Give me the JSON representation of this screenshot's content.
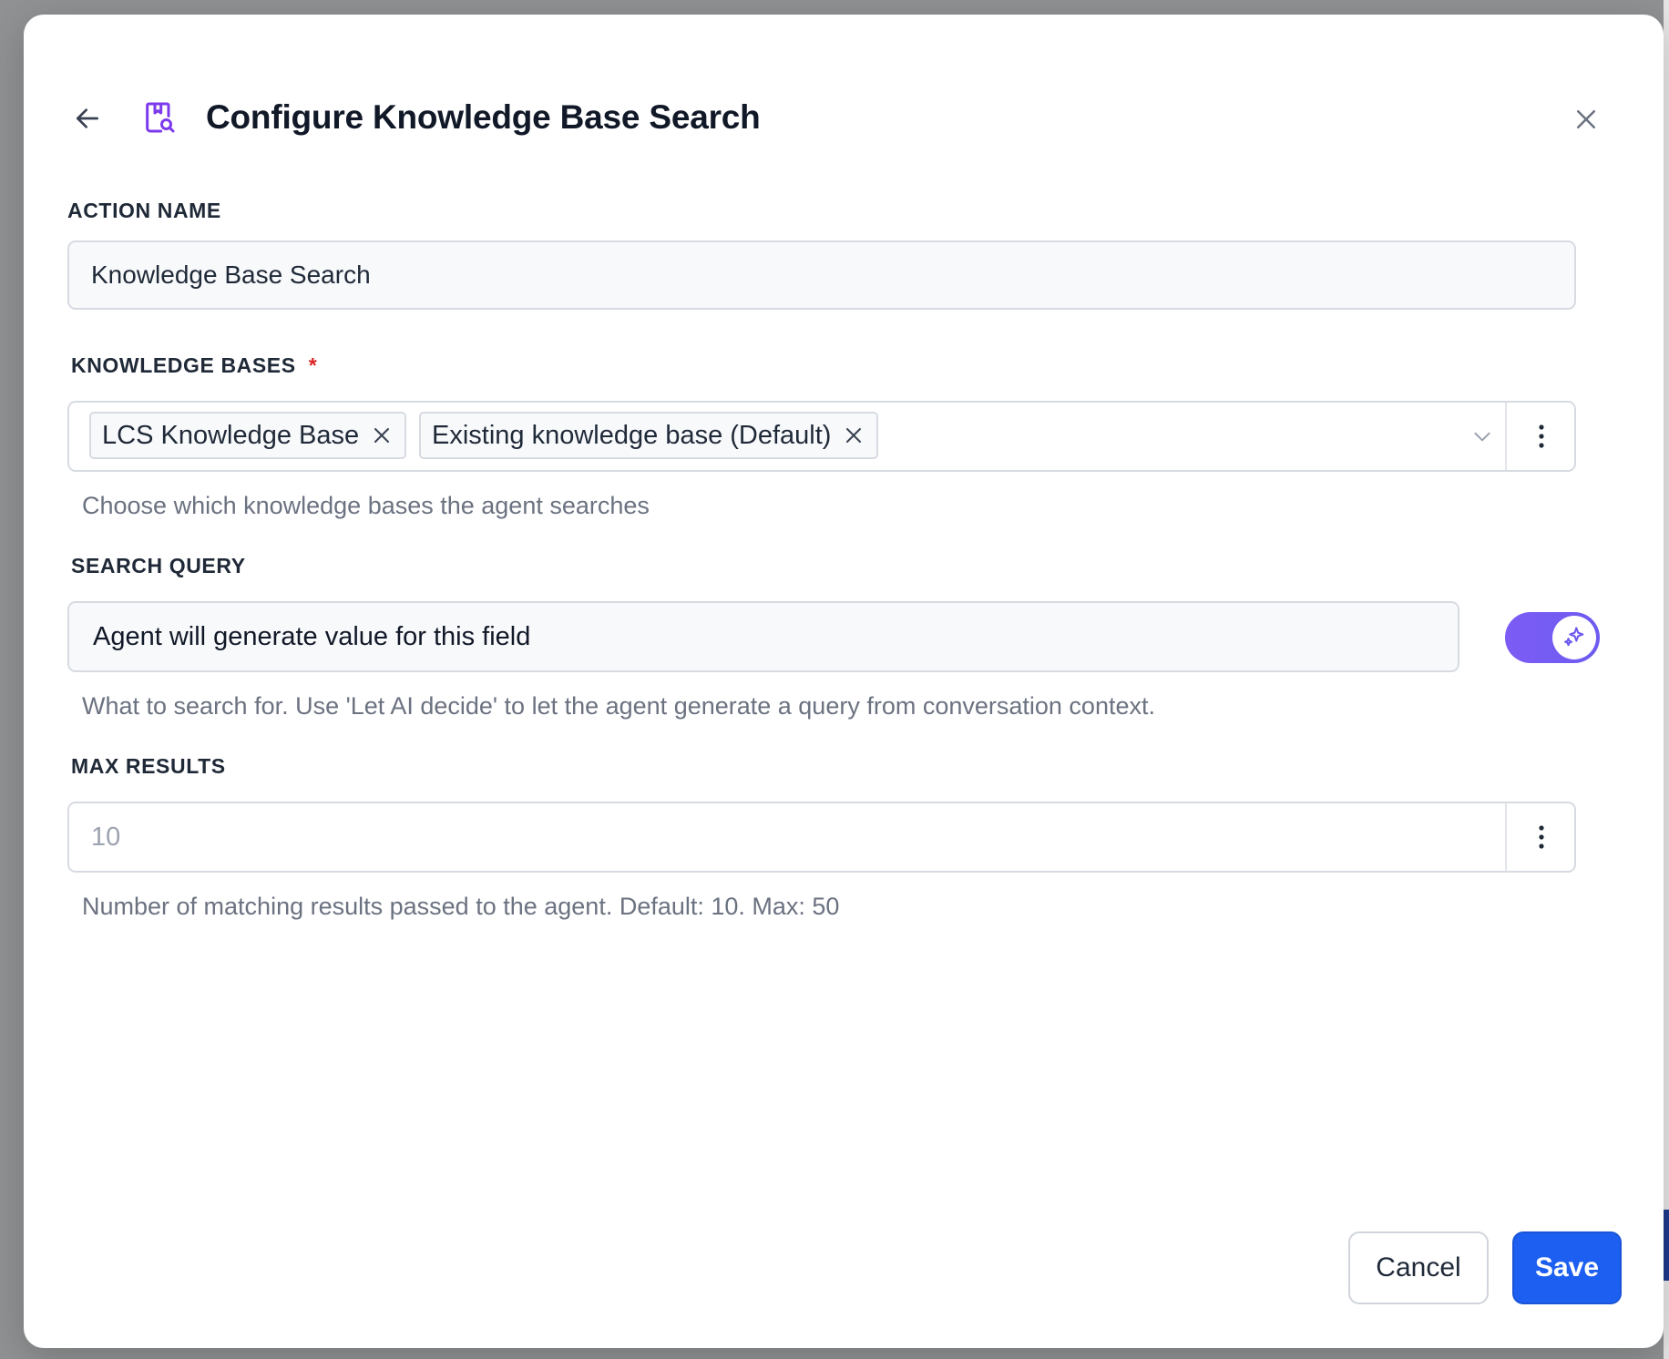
{
  "dialog": {
    "title": "Configure Knowledge Base Search",
    "icons": {
      "back": "arrow-left-icon",
      "title": "knowledge-base-search-icon",
      "close": "close-icon"
    }
  },
  "action_name": {
    "label": "ACTION NAME",
    "value": "Knowledge Base Search"
  },
  "knowledge_bases": {
    "label": "KNOWLEDGE BASES",
    "required_marker": "*",
    "chips": [
      {
        "label": "LCS Knowledge Base"
      },
      {
        "label": "Existing knowledge base (Default)"
      }
    ],
    "help": "Choose which knowledge bases the agent searches"
  },
  "search_query": {
    "label": "SEARCH QUERY",
    "value": "Agent will generate value for this field",
    "ai_toggle_on": true,
    "help": "What to search for. Use 'Let AI decide' to let the agent generate a query from conversation context."
  },
  "max_results": {
    "label": "MAX RESULTS",
    "placeholder": "10",
    "help": "Number of matching results passed to the agent. Default: 10. Max: 50"
  },
  "footer": {
    "cancel_label": "Cancel",
    "save_label": "Save"
  },
  "colors": {
    "primary": "#1d5ff0",
    "accent_purple": "#7c5cf5",
    "required": "#dc2626"
  }
}
